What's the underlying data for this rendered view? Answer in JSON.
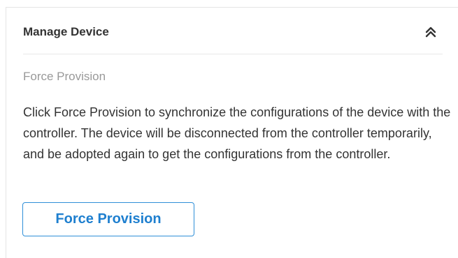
{
  "panel": {
    "title": "Manage Device",
    "collapse_icon": "double-chevron-up-icon"
  },
  "force_provision": {
    "section_label": "Force Provision",
    "description": "Click Force Provision to synchronize the configurations of the device with the controller. The device will be disconnected from the controller temporarily, and be adopted again to get the configurations from the controller.",
    "button_label": "Force Provision"
  },
  "colors": {
    "accent": "#1e7fcf",
    "button_border": "#2f8fd8",
    "title_text": "#333333",
    "muted_text": "#999999"
  }
}
